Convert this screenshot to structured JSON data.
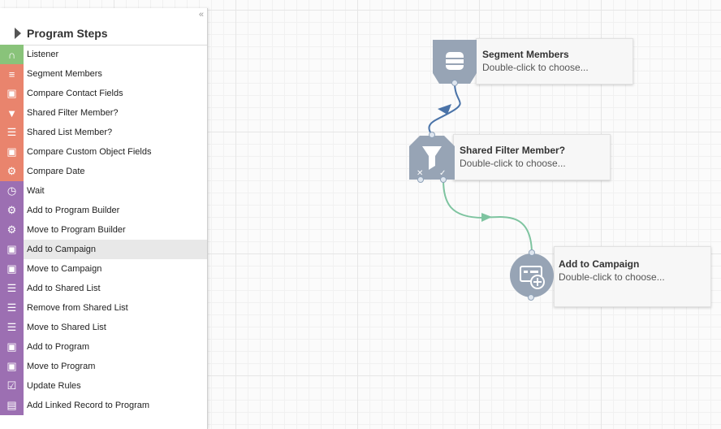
{
  "sidebar": {
    "collapse_glyph": "«",
    "title": "Program Steps",
    "items": [
      {
        "label": "Listener",
        "icon": "headphones-icon",
        "color": "green"
      },
      {
        "label": "Segment Members",
        "icon": "segment-icon",
        "color": "orange"
      },
      {
        "label": "Compare Contact Fields",
        "icon": "contact-card-icon",
        "color": "orange"
      },
      {
        "label": "Shared Filter Member?",
        "icon": "filter-icon",
        "color": "orange"
      },
      {
        "label": "Shared List Member?",
        "icon": "list-icon",
        "color": "orange"
      },
      {
        "label": "Compare Custom Object Fields",
        "icon": "custom-object-icon",
        "color": "orange"
      },
      {
        "label": "Compare Date",
        "icon": "gears-icon",
        "color": "orange"
      },
      {
        "label": "Wait",
        "icon": "clock-icon",
        "color": "purple"
      },
      {
        "label": "Add to Program Builder",
        "icon": "gears-add-icon",
        "color": "purple"
      },
      {
        "label": "Move to Program Builder",
        "icon": "gears-move-icon",
        "color": "purple"
      },
      {
        "label": "Add to Campaign",
        "icon": "campaign-add-icon",
        "color": "purple",
        "selected": true
      },
      {
        "label": "Move to Campaign",
        "icon": "campaign-move-icon",
        "color": "purple"
      },
      {
        "label": "Add to Shared List",
        "icon": "list-add-icon",
        "color": "purple"
      },
      {
        "label": "Remove from Shared List",
        "icon": "list-remove-icon",
        "color": "purple"
      },
      {
        "label": "Move to Shared List",
        "icon": "list-move-icon",
        "color": "purple"
      },
      {
        "label": "Add to Program",
        "icon": "program-add-icon",
        "color": "purple"
      },
      {
        "label": "Move to Program",
        "icon": "program-move-icon",
        "color": "purple"
      },
      {
        "label": "Update Rules",
        "icon": "rules-check-icon",
        "color": "purple"
      },
      {
        "label": "Add Linked Record to Program",
        "icon": "linked-record-icon",
        "color": "purple"
      }
    ]
  },
  "nodes": {
    "segment": {
      "title": "Segment Members",
      "subtitle": "Double-click to choose..."
    },
    "filter": {
      "title": "Shared Filter Member?",
      "subtitle": "Double-click to choose...",
      "no_glyph": "✕",
      "yes_glyph": "✓"
    },
    "campaign": {
      "title": "Add to Campaign",
      "subtitle": "Double-click to choose..."
    }
  },
  "colors": {
    "green": "#89c37a",
    "orange": "#e9846d",
    "purple": "#9c6fb2",
    "node_shape": "#97a4b5",
    "connector_blue": "#4a73a8",
    "connector_green": "#7ec4a0"
  }
}
